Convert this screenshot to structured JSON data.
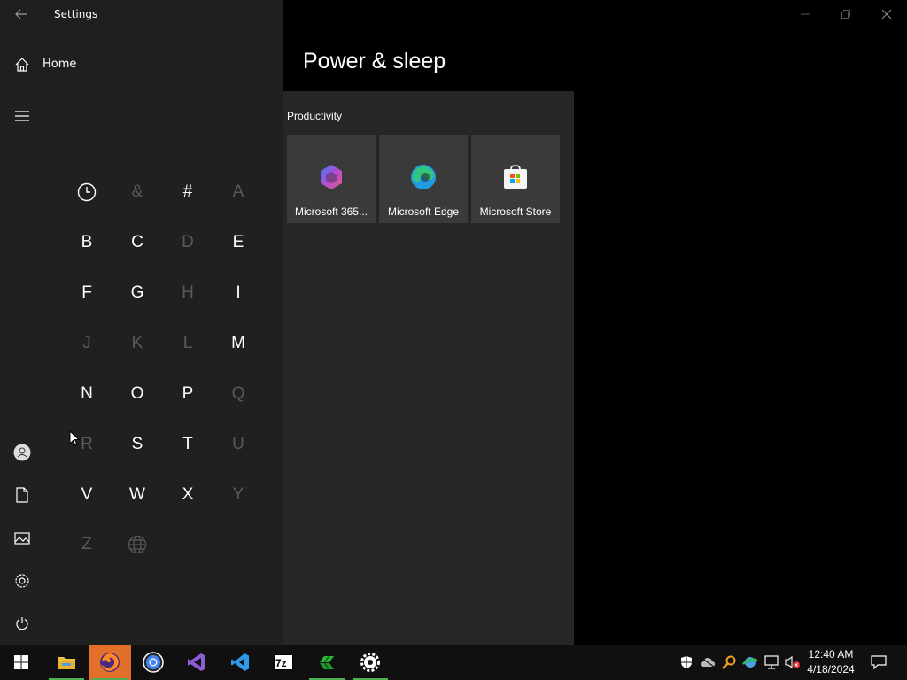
{
  "window": {
    "title": "Settings",
    "page_title": "Power & sleep",
    "home_label": "Home",
    "minimize": "minimize-icon",
    "maximize": "restore-icon",
    "close": "close-icon"
  },
  "start_menu": {
    "rail": [
      "hamburger-menu-icon",
      "user-icon",
      "documents-icon",
      "pictures-icon",
      "settings-icon",
      "power-icon"
    ],
    "letters": [
      {
        "label": "recent-icon",
        "enabled": true
      },
      {
        "label": "&",
        "enabled": false
      },
      {
        "label": "#",
        "enabled": true
      },
      {
        "label": "A",
        "enabled": false
      },
      {
        "label": "B",
        "enabled": true
      },
      {
        "label": "C",
        "enabled": true
      },
      {
        "label": "D",
        "enabled": false
      },
      {
        "label": "E",
        "enabled": true
      },
      {
        "label": "F",
        "enabled": true
      },
      {
        "label": "G",
        "enabled": true
      },
      {
        "label": "H",
        "enabled": false
      },
      {
        "label": "I",
        "enabled": true
      },
      {
        "label": "J",
        "enabled": false
      },
      {
        "label": "K",
        "enabled": false
      },
      {
        "label": "L",
        "enabled": false
      },
      {
        "label": "M",
        "enabled": true
      },
      {
        "label": "N",
        "enabled": true
      },
      {
        "label": "O",
        "enabled": true
      },
      {
        "label": "P",
        "enabled": true
      },
      {
        "label": "Q",
        "enabled": false
      },
      {
        "label": "R",
        "enabled": false
      },
      {
        "label": "S",
        "enabled": true
      },
      {
        "label": "T",
        "enabled": true
      },
      {
        "label": "U",
        "enabled": false
      },
      {
        "label": "V",
        "enabled": true
      },
      {
        "label": "W",
        "enabled": true
      },
      {
        "label": "X",
        "enabled": true
      },
      {
        "label": "Y",
        "enabled": false
      },
      {
        "label": "Z",
        "enabled": false
      },
      {
        "label": "globe-icon",
        "enabled": false
      }
    ],
    "group": "Productivity",
    "tiles": [
      {
        "label": "Microsoft 365...",
        "icon": "microsoft-365-icon"
      },
      {
        "label": "Microsoft Edge",
        "icon": "edge-icon"
      },
      {
        "label": "Microsoft Store",
        "icon": "store-icon"
      }
    ]
  },
  "taskbar": {
    "apps": [
      "start-icon",
      "file-explorer-icon",
      "firefox-icon",
      "chrome-icon",
      "visual-studio-icon",
      "vscode-icon",
      "7zip-icon",
      "green-app-icon",
      "settings-icon"
    ],
    "tray": [
      "shield-icon",
      "cloud-icon",
      "search-tray-icon",
      "network-tray-icon",
      "network-icon",
      "volume-muted-icon"
    ],
    "time": "12:40 AM",
    "date": "4/18/2024",
    "notification": "notification-icon"
  }
}
